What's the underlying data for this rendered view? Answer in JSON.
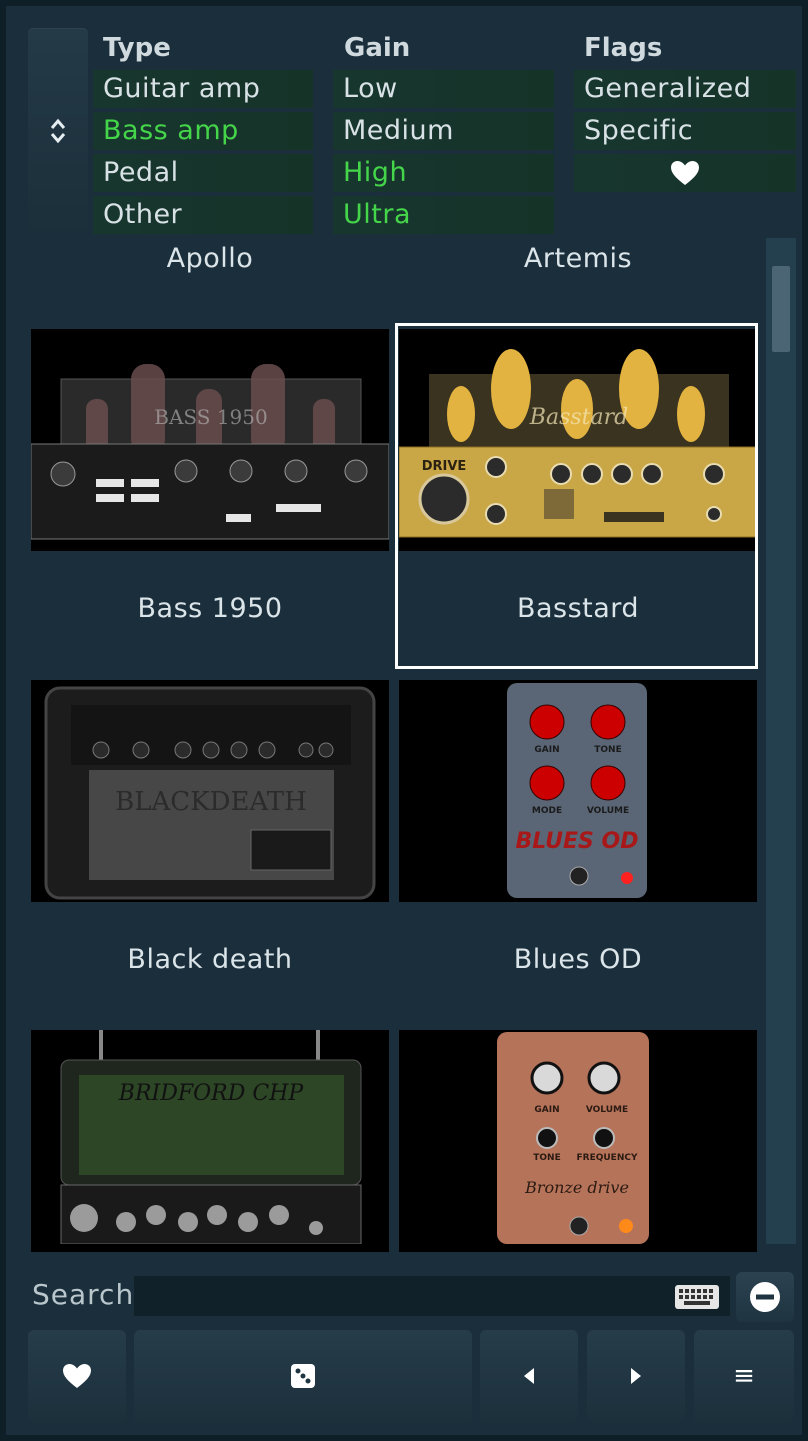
{
  "filters": {
    "collapse_icon": "chevron-up-down-icon",
    "columns": [
      {
        "header": "Type",
        "items": [
          {
            "label": "Guitar amp",
            "active": false
          },
          {
            "label": "Bass amp",
            "active": true
          },
          {
            "label": "Pedal",
            "active": false
          },
          {
            "label": "Other",
            "active": false
          }
        ]
      },
      {
        "header": "Gain",
        "items": [
          {
            "label": "Low",
            "active": false
          },
          {
            "label": "Medium",
            "active": false
          },
          {
            "label": "High",
            "active": true
          },
          {
            "label": "Ultra",
            "active": true
          }
        ]
      },
      {
        "header": "Flags",
        "items": [
          {
            "label": "Generalized",
            "active": false
          },
          {
            "label": "Specific",
            "active": false
          },
          {
            "label": "",
            "icon": "heart-icon",
            "active": false
          }
        ]
      }
    ],
    "active_color": "#45d54a"
  },
  "presets": [
    {
      "name": "Apollo"
    },
    {
      "name": "Artemis"
    },
    {
      "name": "Bass 1950",
      "image_text": "BASS 1950"
    },
    {
      "name": "Basstard",
      "selected": true,
      "image_text": "Basstard",
      "image_button": "DRIVE"
    },
    {
      "name": "Black death",
      "image_text": "BLACKDEATH"
    },
    {
      "name": "Blues OD",
      "image_text": "BLUES OD",
      "knobs": [
        "GAIN",
        "TONE",
        "MODE",
        "VOLUME"
      ]
    },
    {
      "name": "",
      "image_text": "BRIDFORD CHP"
    },
    {
      "name": "",
      "image_text": "Bronze drive",
      "knobs": [
        "GAIN",
        "VOLUME",
        "TONE",
        "FREQUENCY"
      ]
    }
  ],
  "search": {
    "label": "Search",
    "value": "",
    "keyboard_icon": "keyboard-icon",
    "clear_icon": "minus-circle-icon"
  },
  "toolbar": {
    "favorite_icon": "heart-icon",
    "random_icon": "dice-icon",
    "prev_icon": "arrow-left-icon",
    "next_icon": "arrow-right-icon",
    "menu_label": "≡"
  }
}
